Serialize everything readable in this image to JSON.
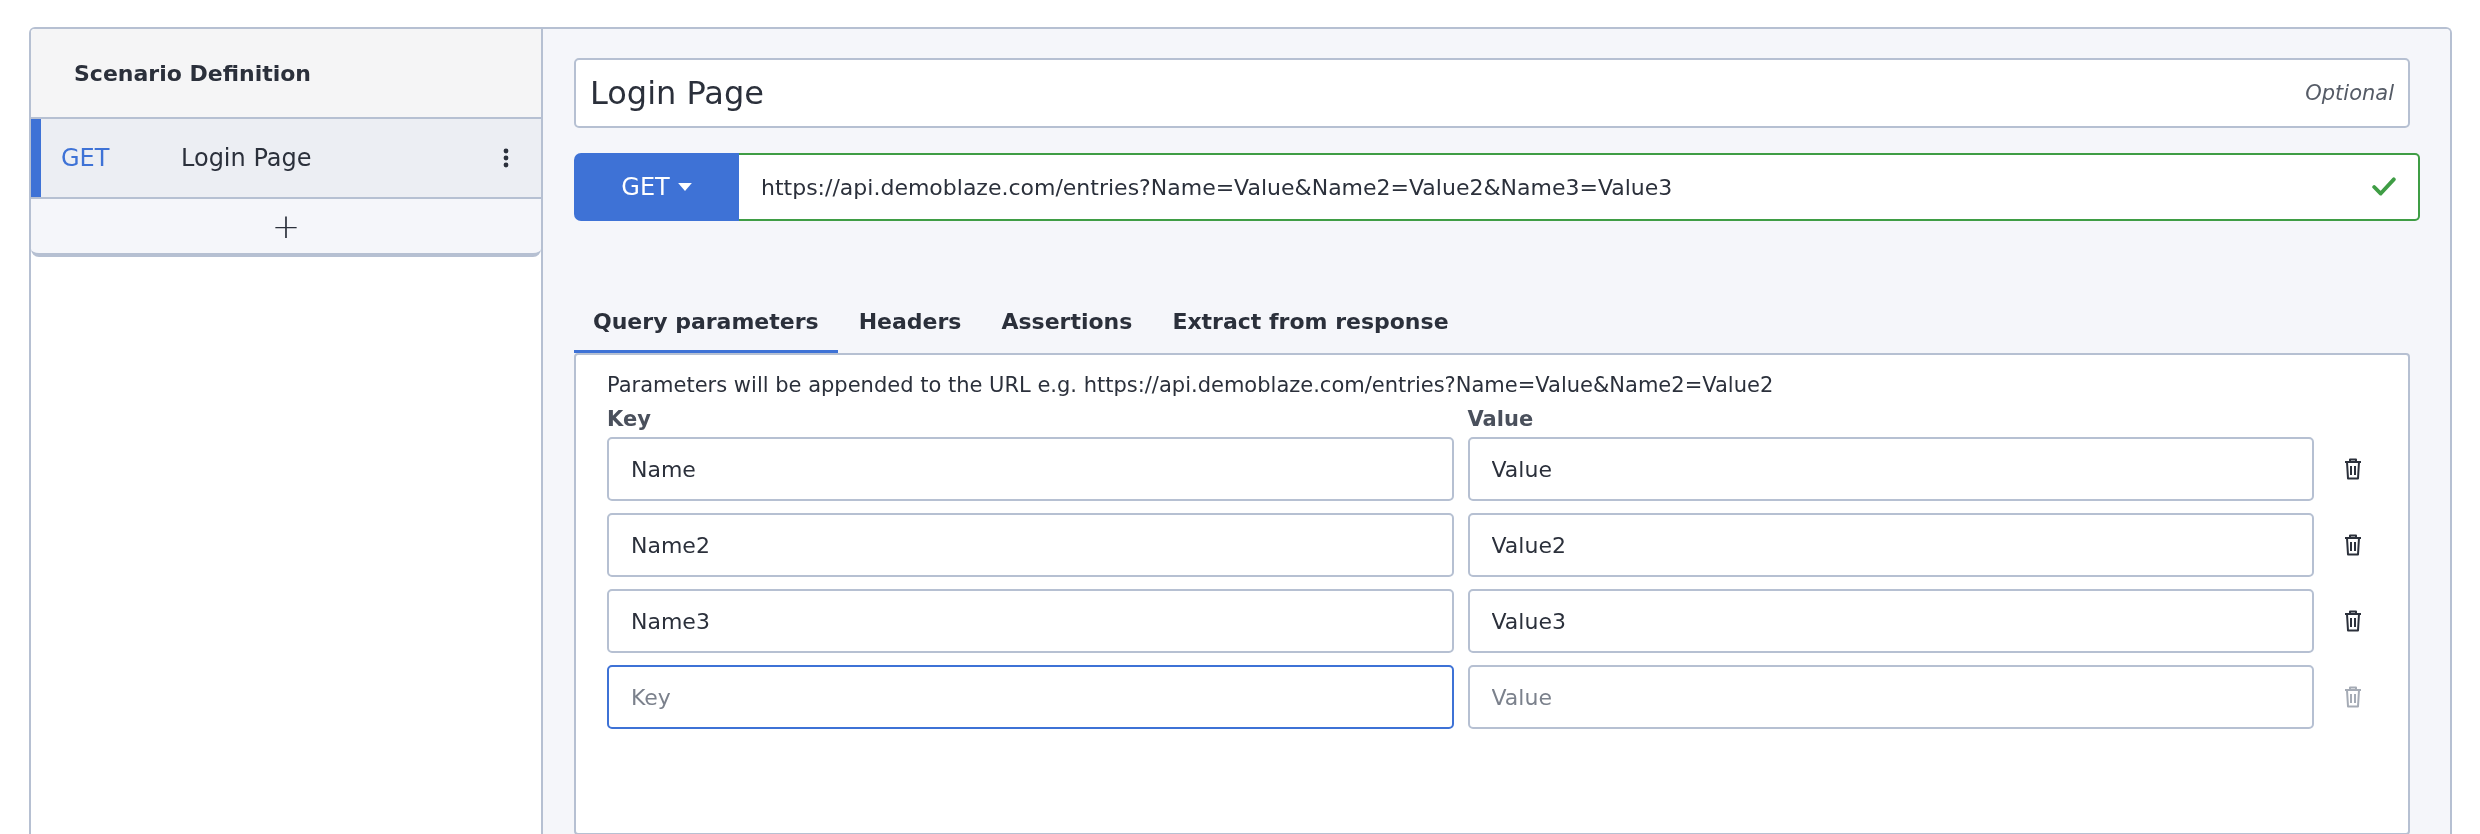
{
  "sidebar": {
    "title": "Scenario Definition",
    "requests": [
      {
        "method": "GET",
        "name": "Login Page",
        "selected": true
      }
    ],
    "add_button": "+"
  },
  "request_name": {
    "value": "Login Page",
    "hint": "Optional"
  },
  "url_bar": {
    "method": "GET",
    "value": "https://api.demoblaze.com/entries?Name=Value&Name2=Value2&Name3=Value3",
    "valid": true
  },
  "tabs": [
    {
      "label": "Query parameters",
      "selected": true
    },
    {
      "label": "Headers",
      "selected": false
    },
    {
      "label": "Assertions",
      "selected": false
    },
    {
      "label": "Extract from response",
      "selected": false
    }
  ],
  "query_parameters": {
    "description": "Parameters will be appended to the URL e.g. https://api.demoblaze.com/entries?Name=Value&Name2=Value2",
    "key_header": "Key",
    "value_header": "Value",
    "rows": [
      {
        "key": "Name",
        "value": "Value",
        "focused": false,
        "disabled": false
      },
      {
        "key": "Name2",
        "value": "Value2",
        "focused": false,
        "disabled": false
      },
      {
        "key": "Name3",
        "value": "Value3",
        "focused": false,
        "disabled": false
      },
      {
        "key_placeholder": "Key",
        "value_placeholder": "Value",
        "focused": true,
        "disabled": true
      }
    ]
  }
}
